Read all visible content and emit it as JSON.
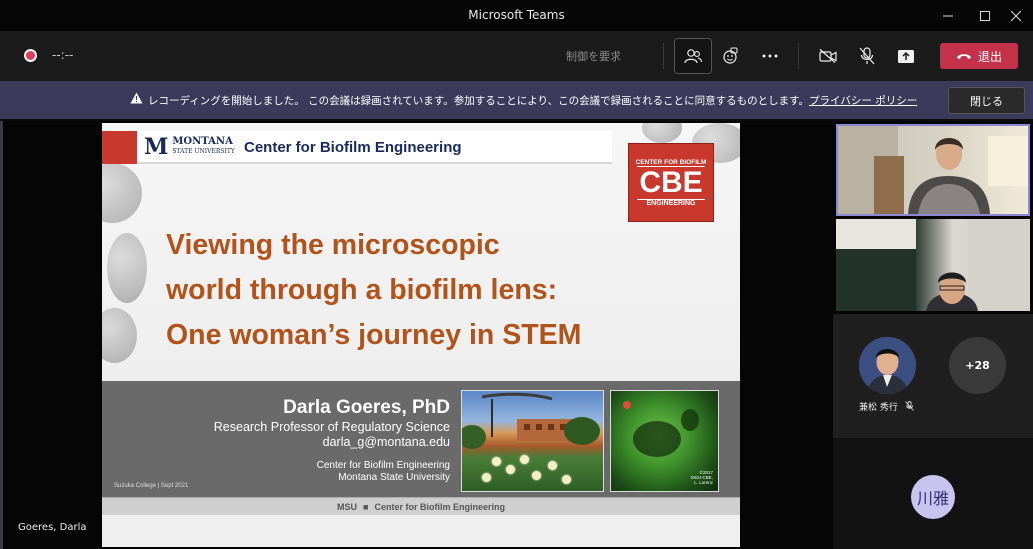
{
  "window": {
    "title": "Microsoft Teams"
  },
  "toolbar": {
    "timer": "--:--",
    "request_control": "制御を要求",
    "leave_label": "退出"
  },
  "banner": {
    "message": "レコーディングを開始しました。 この会議は録画されています。参加することにより、この会議で録画されることに同意するものとします。",
    "privacy_link": "プライバシー ポリシー",
    "close_label": "閉じる"
  },
  "stage": {
    "presenter_label": "Goeres, Darla"
  },
  "slide": {
    "logo_name": "MONTANA",
    "logo_sub": "STATE UNIVERSITY",
    "header": "Center for Biofilm Engineering",
    "badge": {
      "top": "CENTER FOR BIOFILM",
      "main": "CBE",
      "bottom": "ENGINEERING"
    },
    "title_lines": [
      "Viewing the microscopic",
      "world through a biofilm lens:",
      "One woman’s journey in STEM"
    ],
    "speaker_name": "Darla Goeres, PhD",
    "speaker_role": "Research Professor of Regulatory Science",
    "speaker_email": "darla_g@montana.edu",
    "org_line1": "Center for Biofilm Engineering",
    "org_line2": "Montana State University",
    "footnote": "Suzuka College | Sept 2021",
    "photo_credit_1": "©2017",
    "photo_credit_2": "MSU-CBE,",
    "photo_credit_3": "L. Lorenz",
    "footer_left": "MSU",
    "footer_sep": "■",
    "footer_right": "Center for Biofilm Engineering"
  },
  "participants": {
    "roster_name": "兼松 秀行",
    "overflow_count": "+28",
    "initials": "川雅"
  },
  "colors": {
    "leave": "#c4314b",
    "banner": "#3b3a5b",
    "accent_border": "#8b89d6",
    "slide_title": "#b3531c",
    "cbe_red": "#c8382c"
  }
}
